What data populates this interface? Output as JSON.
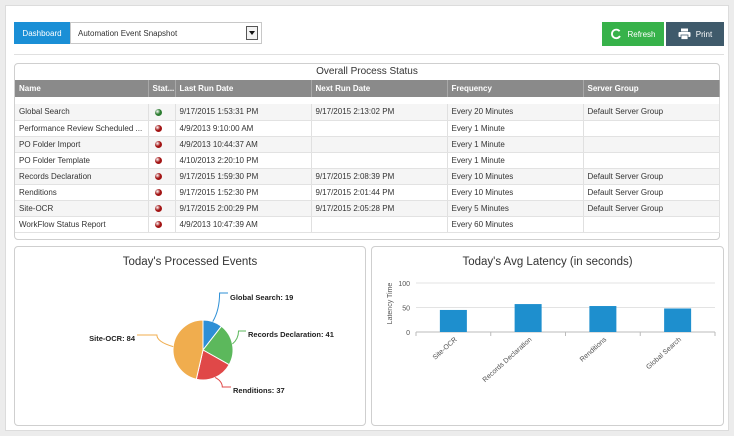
{
  "toolbar": {
    "dashboard_label": "Dashboard",
    "select_value": "Automation Event Snapshot",
    "refresh_label": "Refresh",
    "print_label": "Print"
  },
  "status_panel": {
    "title": "Overall Process Status",
    "columns": [
      "Name",
      "Stat...",
      "Last Run Date",
      "Next Run Date",
      "Frequency",
      "Server Group"
    ],
    "rows": [
      {
        "name": "Global Search",
        "status": "green",
        "last": "9/17/2015 1:53:31 PM",
        "next": "9/17/2015 2:13:02 PM",
        "frequency": "Every 20 Minutes",
        "group": "Default Server Group"
      },
      {
        "name": "Performance Review Scheduled ...",
        "status": "red",
        "last": "4/9/2013 9:10:00 AM",
        "next": "",
        "frequency": "Every 1 Minute",
        "group": ""
      },
      {
        "name": "PO Folder Import",
        "status": "red",
        "last": "4/9/2013 10:44:37 AM",
        "next": "",
        "frequency": "Every 1 Minute",
        "group": ""
      },
      {
        "name": "PO Folder Template",
        "status": "red",
        "last": "4/10/2013 2:20:10 PM",
        "next": "",
        "frequency": "Every 1 Minute",
        "group": ""
      },
      {
        "name": "Records Declaration",
        "status": "red",
        "last": "9/17/2015 1:59:30 PM",
        "next": "9/17/2015 2:08:39 PM",
        "frequency": "Every 10 Minutes",
        "group": "Default Server Group"
      },
      {
        "name": "Renditions",
        "status": "red",
        "last": "9/17/2015 1:52:30 PM",
        "next": "9/17/2015 2:01:44 PM",
        "frequency": "Every 10 Minutes",
        "group": "Default Server Group"
      },
      {
        "name": "Site-OCR",
        "status": "red",
        "last": "9/17/2015 2:00:29 PM",
        "next": "9/17/2015 2:05:28 PM",
        "frequency": "Every 5 Minutes",
        "group": "Default Server Group"
      },
      {
        "name": "WorkFlow Status Report",
        "status": "red",
        "last": "4/9/2013 10:47:39 AM",
        "next": "",
        "frequency": "Every 60 Minutes",
        "group": ""
      }
    ]
  },
  "colors": {
    "green": "#2e7d32",
    "red": "#a31515",
    "accent": "#1a8fd6"
  },
  "chart_data": [
    {
      "type": "pie",
      "title": "Today's Processed Events",
      "slices": [
        {
          "label": "Global Search",
          "value": 19,
          "color": "#2d8fd6"
        },
        {
          "label": "Records Declaration",
          "value": 41,
          "color": "#5cb85c"
        },
        {
          "label": "Renditions",
          "value": 37,
          "color": "#e04848"
        },
        {
          "label": "Site-OCR",
          "value": 84,
          "color": "#f0ad4e"
        }
      ]
    },
    {
      "type": "bar",
      "title": "Today's Avg Latency (in seconds)",
      "xlabel": "",
      "ylabel": "Latency Time",
      "ylim": [
        0,
        100
      ],
      "yticks": [
        0,
        50,
        100
      ],
      "grid": true,
      "categories": [
        "Site-OCR",
        "Records Declaration",
        "Renditions",
        "Global Search"
      ],
      "values": [
        45,
        57,
        53,
        48
      ],
      "color": "#1e8fce"
    }
  ]
}
